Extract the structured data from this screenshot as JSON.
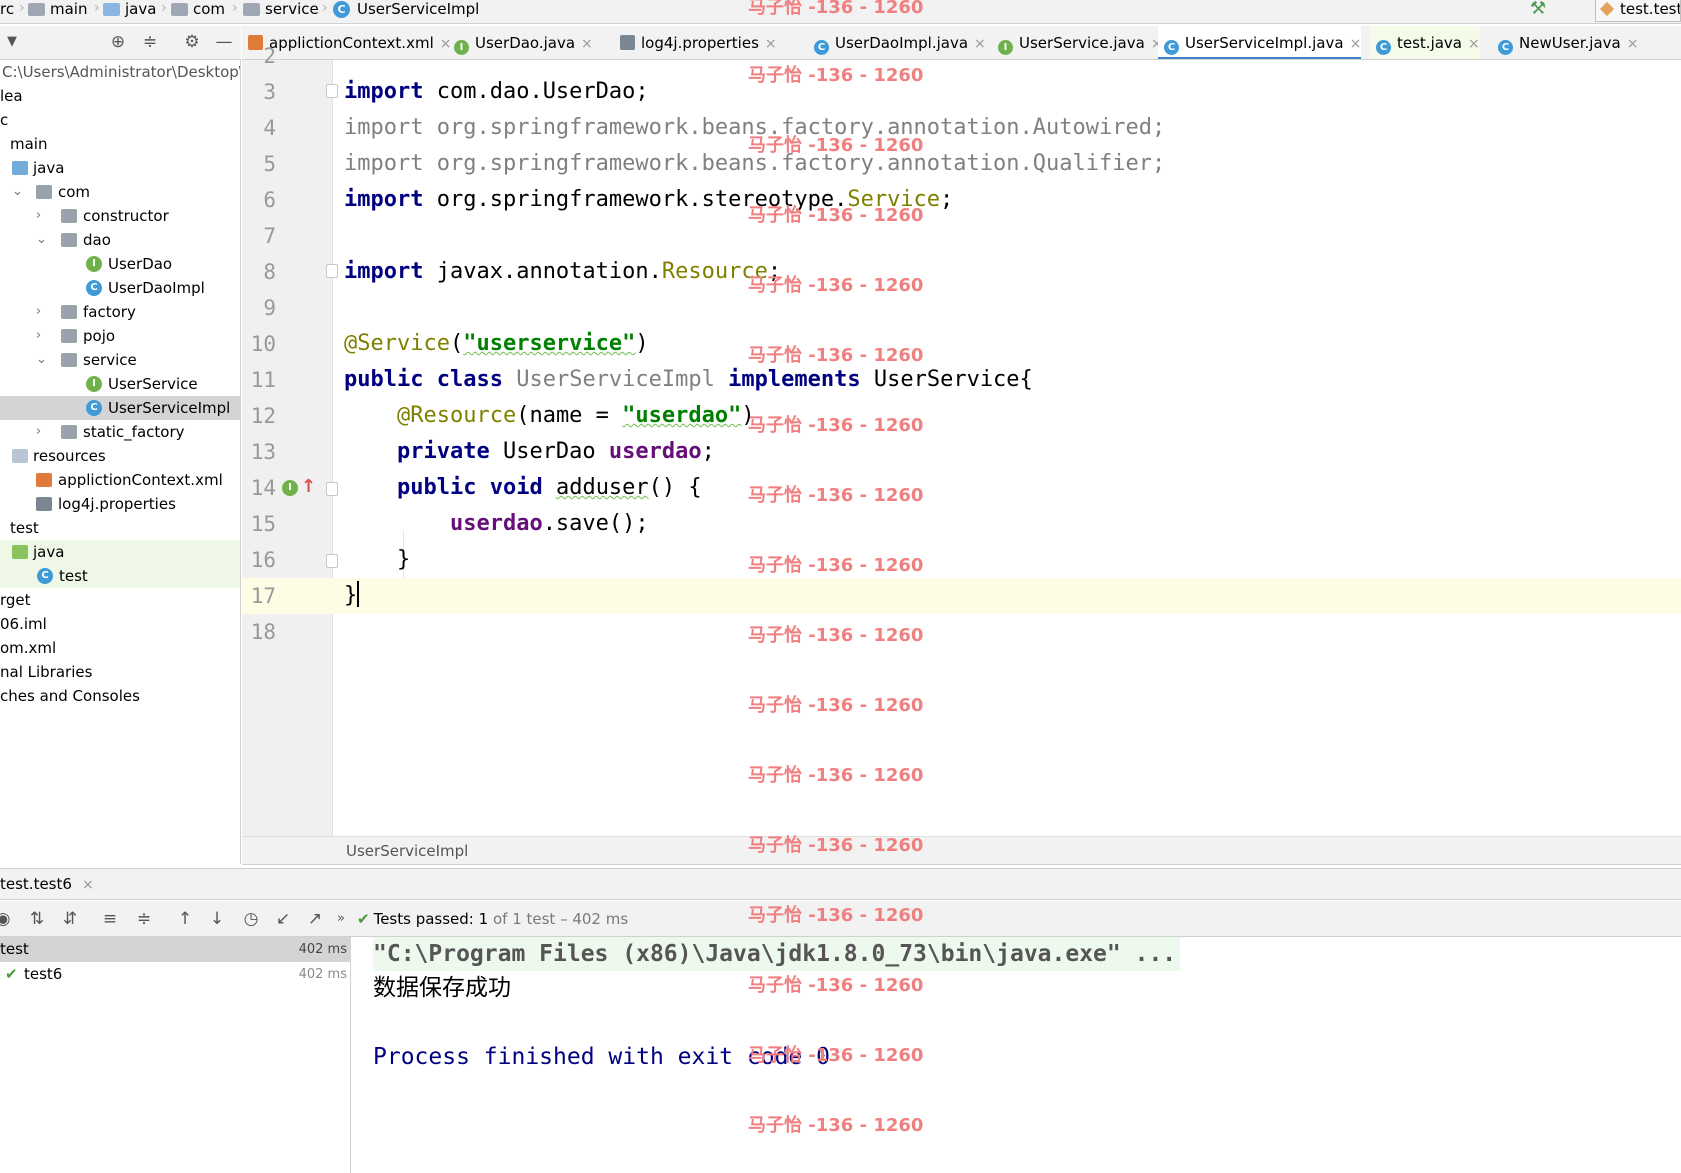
{
  "nav": {
    "crumbs": [
      "rc",
      "main",
      "java",
      "com",
      "service",
      "UserServiceImpl"
    ],
    "run_config": "test.test"
  },
  "tabs": [
    {
      "label": "applictionContext.xml",
      "icon": "xml-file-icon"
    },
    {
      "label": "UserDao.java",
      "icon": "interface-icon"
    },
    {
      "label": "log4j.properties",
      "icon": "properties-file-icon"
    },
    {
      "label": "UserDaoImpl.java",
      "icon": "class-icon"
    },
    {
      "label": "UserService.java",
      "icon": "interface-icon"
    },
    {
      "label": "UserServiceImpl.java",
      "icon": "class-icon",
      "active": true
    },
    {
      "label": "test.java",
      "icon": "test-class-icon"
    },
    {
      "label": "NewUser.java",
      "icon": "class-icon"
    }
  ],
  "tree": {
    "path": "C:\\Users\\Administrator\\Desktop\\",
    "items": [
      {
        "label": "lea"
      },
      {
        "label": "c"
      },
      {
        "label": "main"
      },
      {
        "label": "java"
      },
      {
        "label": "com"
      },
      {
        "label": "constructor"
      },
      {
        "label": "dao"
      },
      {
        "label": "UserDao"
      },
      {
        "label": "UserDaoImpl"
      },
      {
        "label": "factory"
      },
      {
        "label": "pojo"
      },
      {
        "label": "service"
      },
      {
        "label": "UserService"
      },
      {
        "label": "UserServiceImpl"
      },
      {
        "label": "static_factory"
      },
      {
        "label": "resources"
      },
      {
        "label": "applictionContext.xml"
      },
      {
        "label": "log4j.properties"
      },
      {
        "label": "test"
      },
      {
        "label": "java"
      },
      {
        "label": "test"
      },
      {
        "label": "rget"
      },
      {
        "label": "06.iml"
      },
      {
        "label": "om.xml"
      },
      {
        "label": "nal Libraries"
      },
      {
        "label": "ches and Consoles"
      }
    ]
  },
  "editor": {
    "line_numbers": [
      "2",
      "3",
      "4",
      "5",
      "6",
      "7",
      "8",
      "9",
      "10",
      "11",
      "12",
      "13",
      "14",
      "15",
      "16",
      "17",
      "18"
    ],
    "code": {
      "l3_kw": "import",
      "l3_rest": " com.dao.UserDao;",
      "l4_kw": "import",
      "l4_rest": " org.springframework.beans.factory.annotation.Autowired;",
      "l5_kw": "import",
      "l5_rest": " org.springframework.beans.factory.annotation.Qualifier;",
      "l6_kw": "import",
      "l6_rest": " org.springframework.stereotype.",
      "l6_ann": "Service",
      "l6_end": ";",
      "l8_kw": "import",
      "l8_rest": " javax.annotation.",
      "l8_ann": "Resource",
      "l8_end": ";",
      "l10_ann": "@Service",
      "l10_p1": "(",
      "l10_str": "\"userservice\"",
      "l10_p2": ")",
      "l11_kw1": "public",
      "l11_kw2": "class",
      "l11_name": "UserServiceImpl",
      "l11_kw3": "implements",
      "l11_rest": " UserService{",
      "l12_ann": "@Resource",
      "l12_p1": "(name = ",
      "l12_str": "\"userdao\"",
      "l12_p2": ")",
      "l13_kw": "private",
      "l13_type": " UserDao ",
      "l13_fld": "userdao",
      "l13_end": ";",
      "l14_kw1": "public",
      "l14_kw2": "void",
      "l14_name": "adduser",
      "l14_rest": "() {",
      "l15_fld": "userdao",
      "l15_rest": ".save();",
      "l16": "}",
      "l17": "}"
    },
    "breadcrumb": "UserServiceImpl"
  },
  "run": {
    "tab_label": "test.test6",
    "tests_passed_label": "Tests passed:",
    "tests_passed_count": "1",
    "tests_passed_rest": "of 1 test – 402 ms",
    "results": [
      {
        "name": "test",
        "time": "402 ms"
      },
      {
        "name": "test6",
        "time": "402 ms"
      }
    ],
    "console": {
      "command": "\"C:\\Program Files (x86)\\Java\\jdk1.8.0_73\\bin\\java.exe\" ...",
      "output": "数据保存成功",
      "exit": "Process finished with exit code 0"
    }
  },
  "watermark": "马子怡 -136 - 1260"
}
